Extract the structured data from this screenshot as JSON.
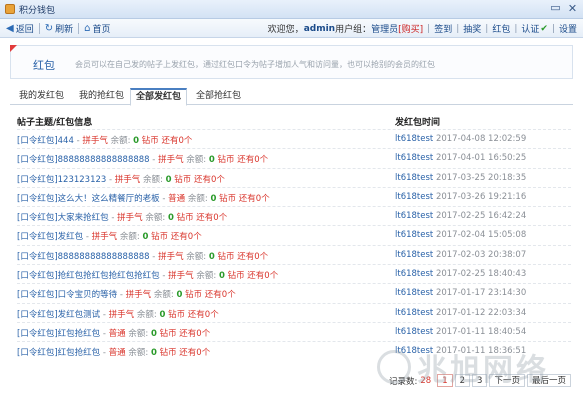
{
  "window": {
    "title": "积分钱包"
  },
  "toolbar": {
    "back": "返回",
    "refresh": "刷新",
    "home": "首页",
    "welcome": "欢迎您，",
    "username": "admin",
    "group_label": " 用户组：",
    "group": "管理员",
    "buy": "[购买]",
    "checkin": "签到",
    "lottery": "抽奖",
    "redpacket": "红包",
    "verify": "认证",
    "settings": "设置"
  },
  "intro": {
    "title": "红包",
    "desc": "会员可以在自己发的帖子上发红包，通过红包口令为帖子增加人气和访问量，也可以抢别的会员的红包"
  },
  "tabs": [
    "我的发红包",
    "我的抢红包",
    "全部发红包",
    "全部抢红包"
  ],
  "active_tab": 2,
  "table": {
    "headers": [
      "帖子主题/红包信息",
      "发红包时间"
    ],
    "rows": [
      {
        "tag": "[口令红包]",
        "subject": "444",
        "type": "拼手气",
        "label": "余额:",
        "amount": "0",
        "unit": "钻币",
        "remain": "还有0个",
        "user": "lt618test",
        "time": "2017-04-08 12:02:59"
      },
      {
        "tag": "[口令红包]",
        "subject": "88888888888888888",
        "type": "拼手气",
        "label": "余额:",
        "amount": "0",
        "unit": "钻币",
        "remain": "还有0个",
        "user": "lt618test",
        "time": "2017-04-01 16:50:25"
      },
      {
        "tag": "[口令红包]",
        "subject": "123123123",
        "type": "拼手气",
        "label": "余额:",
        "amount": "0",
        "unit": "钻币",
        "remain": "还有0个",
        "user": "lt618test",
        "time": "2017-03-25 20:18:35"
      },
      {
        "tag": "[口令红包]",
        "subject": "这么大！这么精餐厅的老板",
        "type": "普通",
        "label": "余额:",
        "amount": "0",
        "unit": "钻币",
        "remain": "还有0个",
        "user": "lt618test",
        "time": "2017-03-26 19:21:16"
      },
      {
        "tag": "[口令红包]",
        "subject": "大家来抢红包",
        "type": "拼手气",
        "label": "余额:",
        "amount": "0",
        "unit": "钻币",
        "remain": "还有0个",
        "user": "lt618test",
        "time": "2017-02-25 16:42:24"
      },
      {
        "tag": "[口令红包]",
        "subject": "发红包",
        "type": "拼手气",
        "label": "余额:",
        "amount": "0",
        "unit": "钻币",
        "remain": "还有0个",
        "user": "lt618test",
        "time": "2017-02-04 15:05:08"
      },
      {
        "tag": "[口令红包]",
        "subject": "88888888888888888",
        "type": "拼手气",
        "label": "余额:",
        "amount": "0",
        "unit": "钻币",
        "remain": "还有0个",
        "user": "lt618test",
        "time": "2017-02-03 20:38:07"
      },
      {
        "tag": "[口令红包]",
        "subject": "抢红包抢红包抢红包抢红包",
        "type": "拼手气",
        "label": "余额:",
        "amount": "0",
        "unit": "钻币",
        "remain": "还有0个",
        "user": "lt618test",
        "time": "2017-02-25 18:40:43"
      },
      {
        "tag": "[口令红包]",
        "subject": "口令宝贝的等待",
        "type": "拼手气",
        "label": "余额:",
        "amount": "0",
        "unit": "钻币",
        "remain": "还有0个",
        "user": "lt618test",
        "time": "2017-01-17 23:14:30"
      },
      {
        "tag": "[口令红包]",
        "subject": "发红包测试",
        "type": "拼手气",
        "label": "余额:",
        "amount": "0",
        "unit": "钻币",
        "remain": "还有0个",
        "user": "lt618test",
        "time": "2017-01-12 22:03:34"
      },
      {
        "tag": "[口令红包]",
        "subject": "红包抢红包",
        "type": "普通",
        "label": "余额:",
        "amount": "0",
        "unit": "钻币",
        "remain": "还有0个",
        "user": "lt618test",
        "time": "2017-01-11 18:40:54"
      },
      {
        "tag": "[口令红包]",
        "subject": "红包抢红包",
        "type": "普通",
        "label": "余额:",
        "amount": "0",
        "unit": "钻币",
        "remain": "还有0个",
        "user": "lt618test",
        "time": "2017-01-11 18:36:51"
      }
    ]
  },
  "pager": {
    "label": "记录数:",
    "total": "28",
    "pages": [
      "1",
      "2",
      "3",
      "下一页",
      "最后一页"
    ],
    "current": "1"
  },
  "watermark": {
    "text": "兆旭网络"
  }
}
